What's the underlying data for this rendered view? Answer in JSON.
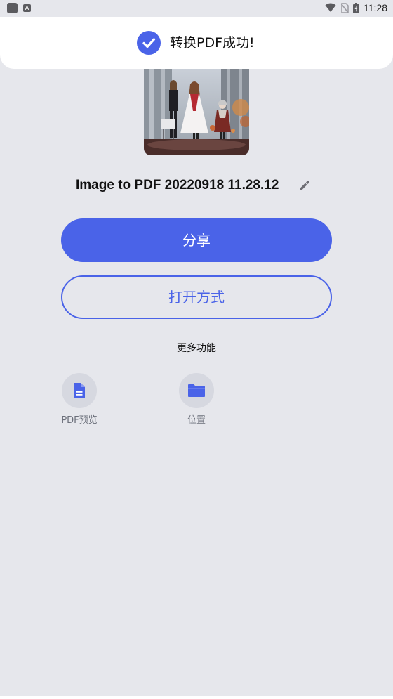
{
  "status_bar": {
    "time": "11:28",
    "left_icons": [
      "app-icon",
      "a-icon"
    ],
    "right_icons": [
      "wifi-icon",
      "no-sim-icon",
      "battery-icon"
    ]
  },
  "toast": {
    "icon": "check-circle-icon",
    "message": "转换PDF成功!"
  },
  "file": {
    "name": "Image to PDF 20220918 11.28.12",
    "edit_icon": "pencil-icon"
  },
  "actions": {
    "share_label": "分享",
    "open_with_label": "打开方式"
  },
  "more_features": {
    "title": "更多功能",
    "items": [
      {
        "label": "PDF预览",
        "icon": "document-icon"
      },
      {
        "label": "位置",
        "icon": "folder-icon"
      }
    ]
  },
  "colors": {
    "accent": "#4a63e8",
    "background": "#e6e7ec",
    "toast_background": "#ffffff",
    "feature_circle": "#d6d8e0"
  }
}
